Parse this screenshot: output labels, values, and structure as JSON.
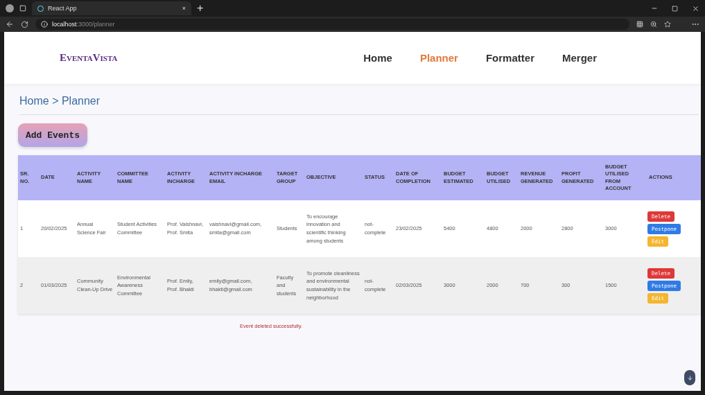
{
  "browser": {
    "tab_title": "React App",
    "tab_close": "×",
    "new_tab": "+",
    "url_host": "localhost",
    "url_path": ":3000/planner"
  },
  "nav": {
    "logo": "EventaVista",
    "links": [
      {
        "label": "Home",
        "selected": false
      },
      {
        "label": "Planner",
        "selected": true
      },
      {
        "label": "Formatter",
        "selected": false
      },
      {
        "label": "Merger",
        "selected": false
      }
    ]
  },
  "breadcrumb": "Home > Planner",
  "add_button": "Add Events",
  "table": {
    "columns": [
      "SR. NO.",
      "DATE",
      "ACTIVITY NAME",
      "COMMITTEE NAME",
      "ACTIVITY INCHARGE",
      "ACTIVITY INCHARGE EMAIL",
      "TARGET GROUP",
      "OBJECTIVE",
      "STATUS",
      "DATE OF COMPLETION",
      "BUDGET ESTIMATED",
      "BUDGET UTILISED",
      "REVENUE GENERATED",
      "PROFIT GENERATED",
      "BUDGET UTILISED FROM ACCOUNT",
      "ACTIONS"
    ],
    "rows": [
      {
        "cells": [
          "1",
          "20/02/2025",
          "Annual Science Fair",
          "Student Activities Committee",
          "Prof. Vaishnavi, Prof. Smita",
          "vaishnavi@gmail.com, smita@gmail.com",
          "Students",
          "To encourage innovation and scientific thinking among students",
          "not-complete",
          "23/02/2025",
          "5400",
          "4800",
          "2000",
          "2800",
          "3000"
        ],
        "actions": [
          {
            "label": "Delete",
            "kind": "delete"
          },
          {
            "label": "Postpone",
            "kind": "postpone"
          },
          {
            "label": "Edit",
            "kind": "edit"
          }
        ]
      },
      {
        "cells": [
          "2",
          "01/03/2025",
          "Community Clean-Up Drive",
          "Environmental Awareness Committee",
          "Prof. Emily, Prof. Bhakti",
          "emily@gmail.com, bhakti@gmail.com",
          "Faculty and students",
          "To promote cleanliness and environmental sustainability in the neighborhood",
          "not-complete",
          "02/03/2025",
          "3000",
          "2000",
          "700",
          "300",
          "1500"
        ],
        "actions": [
          {
            "label": "Delete",
            "kind": "delete"
          },
          {
            "label": "Postpone",
            "kind": "postpone"
          },
          {
            "label": "Edit",
            "kind": "edit"
          }
        ]
      }
    ]
  },
  "message": "Event deleted successfully."
}
